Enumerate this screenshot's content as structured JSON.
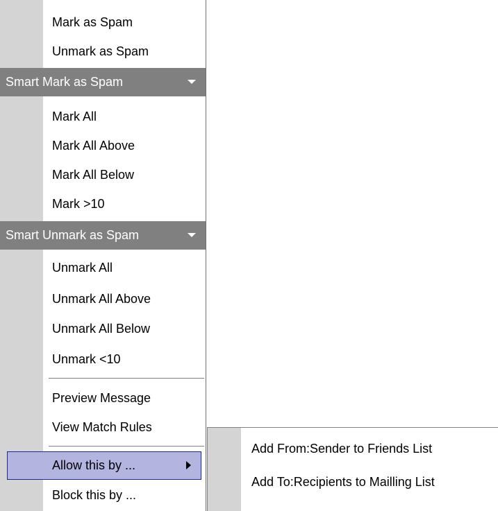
{
  "menu": {
    "items": [
      {
        "label": "Mark as Spam"
      },
      {
        "label": "Unmark as Spam"
      }
    ],
    "smart_mark": {
      "header": "Smart Mark as Spam",
      "items": [
        {
          "label": "Mark All"
        },
        {
          "label": "Mark All Above"
        },
        {
          "label": "Mark All Below"
        },
        {
          "label": "Mark >10"
        }
      ]
    },
    "smart_unmark": {
      "header": "Smart Unmark as Spam",
      "items": [
        {
          "label": "Unmark All"
        },
        {
          "label": "Unmark All Above"
        },
        {
          "label": "Unmark All Below"
        },
        {
          "label": "Unmark <10"
        }
      ]
    },
    "view_items": [
      {
        "label": "Preview Message"
      },
      {
        "label": "View Match Rules"
      }
    ],
    "action_items": [
      {
        "label": "Allow this by ...",
        "active": true,
        "has_submenu": true
      },
      {
        "label": "Block this by ..."
      }
    ]
  },
  "submenu": {
    "items": [
      {
        "label": "Add From:Sender to Friends List"
      },
      {
        "label": "Add To:Recipients to Mailling List"
      }
    ]
  },
  "colors": {
    "gutter": "#d4d4d4",
    "section_header_bg": "#808080",
    "active_bg": "#b4b4e0",
    "active_border": "#1a2a8a"
  },
  "icons": {
    "section_caret": "chevron-down-icon",
    "submenu_arrow": "chevron-right-icon"
  }
}
